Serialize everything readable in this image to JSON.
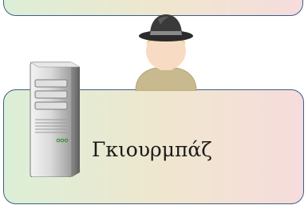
{
  "node_label": "Γκιουρμπάζ",
  "icons": {
    "user": "user-hat-icon",
    "server": "server-tower-icon"
  },
  "colors": {
    "panel_border": "#3a5f8a",
    "panel_gradient_left": "#dcefd6",
    "panel_gradient_right": "#f6dcdc"
  }
}
